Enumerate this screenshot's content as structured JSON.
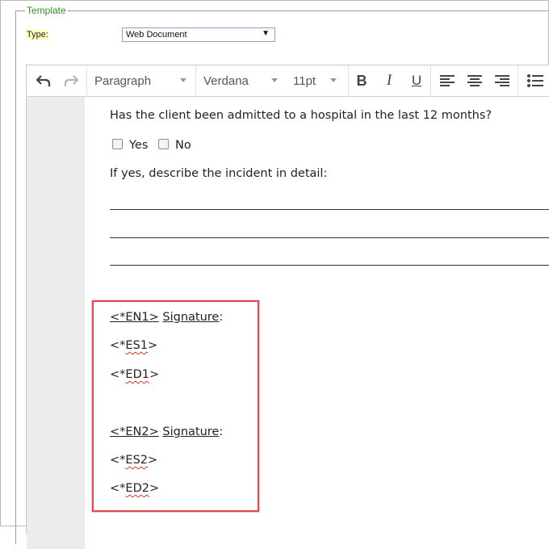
{
  "template": {
    "legend": "Template",
    "type_label": "Type:",
    "type_value": "Web Document"
  },
  "toolbar": {
    "paragraph": "Paragraph",
    "font": "Verdana",
    "size": "11pt"
  },
  "content": {
    "question": "Has the client been admitted to a hospital in the last 12 months?",
    "yes": "Yes",
    "no": "No",
    "if_yes": "If yes, describe the incident in detail:",
    "en1_tag": "<*EN1>",
    "en1_sig": "Signature",
    "en1_colon": ":",
    "es1_prefix": "<*",
    "es1_code": "ES1",
    "es1_suffix": ">",
    "ed1_prefix": "<*",
    "ed1_code": "ED1",
    "ed1_suffix": ">",
    "en2_tag": "<*EN2>",
    "en2_sig": "Signature",
    "en2_colon": ":",
    "es2_prefix": "<*",
    "es2_code": "ES2",
    "es2_suffix": ">",
    "ed2_prefix": "<*",
    "ed2_code": "ED2",
    "ed2_suffix": ">"
  },
  "colors": {
    "legend": "#3b8a2e",
    "highlight_box": "#e14848",
    "type_label_bg": "#ffffc2"
  }
}
